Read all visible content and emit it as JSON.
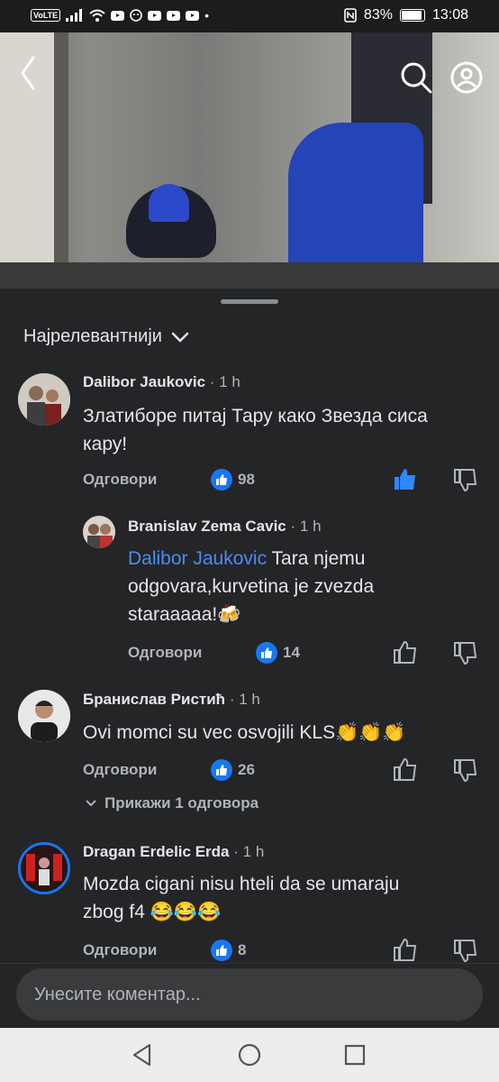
{
  "status_bar": {
    "volte": "VoLTE",
    "battery": "83%",
    "time": "13:08"
  },
  "sort": {
    "label": "Најрелевантнији"
  },
  "comments": [
    {
      "name": "Dalibor Jaukovic",
      "time": "1 h",
      "text": "Златиборе питај Тару како Звезда сиса кару!",
      "reply": "Одговори",
      "likes": "98"
    },
    {
      "name": "Branislav Zema Cavic",
      "time": "1 h",
      "mention": "Dalibor Jaukovic",
      "text_line1": " Tara njemu",
      "text_line2": "odgovara,kurvetina je zvezda",
      "text_line3": "staraaaaa!🍻",
      "reply": "Одговори",
      "likes": "14"
    },
    {
      "name": "Бранислав Ристић",
      "time": "1 h",
      "text": "Ovi momci su vec osvojili KLS👏👏👏",
      "reply": "Одговори",
      "likes": "26",
      "show_replies": "Прикажи 1 одговора"
    },
    {
      "name": "Dragan Erdelic Erda",
      "time": "1 h",
      "text_line1": "Mozda cigani nisu hteli da se umaraju",
      "text_line2": "zbog f4 😂😂😂",
      "reply": "Одговори",
      "likes": "8"
    }
  ],
  "composer": {
    "placeholder": "Унесите коментар..."
  }
}
